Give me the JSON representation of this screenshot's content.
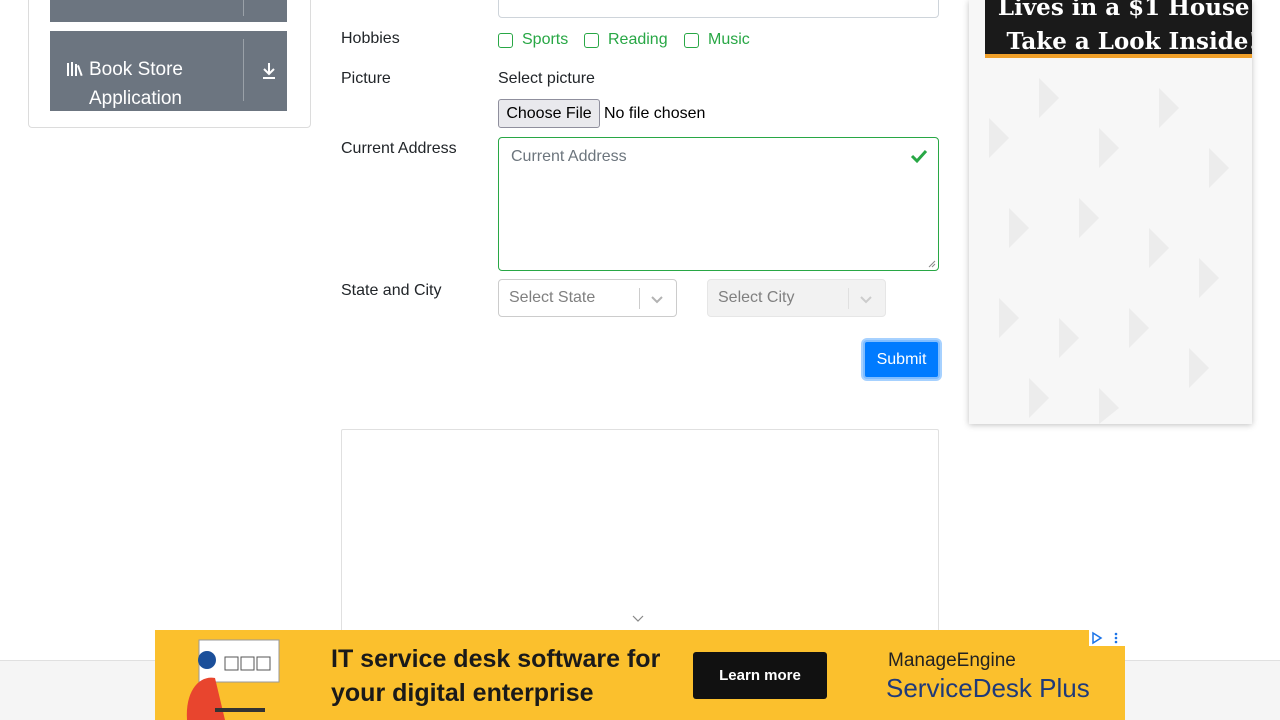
{
  "sidebar": {
    "book_store_label": "Book Store Application"
  },
  "form": {
    "hobbies_label": "Hobbies",
    "hobbies": [
      "Sports",
      "Reading",
      "Music"
    ],
    "picture_label": "Picture",
    "select_picture": "Select picture",
    "choose_file": "Choose File",
    "no_file": "No file chosen",
    "address_label": "Current Address",
    "address_placeholder": "Current Address",
    "state_city_label": "State and City",
    "state_placeholder": "Select State",
    "city_placeholder": "Select City",
    "submit_label": "Submit"
  },
  "right_ad": {
    "headline": "Lives in a $1 House - Take a Look Inside!"
  },
  "bottom_ad": {
    "headline": "IT service desk software for your digital enterprise",
    "cta": "Learn more",
    "brand": "ManageEngine",
    "product": "ServiceDesk Plus"
  },
  "colors": {
    "accent": "#007bff",
    "valid": "#28a745",
    "sidebar_item": "#6c7580",
    "ad_yellow": "#fbc02d"
  }
}
